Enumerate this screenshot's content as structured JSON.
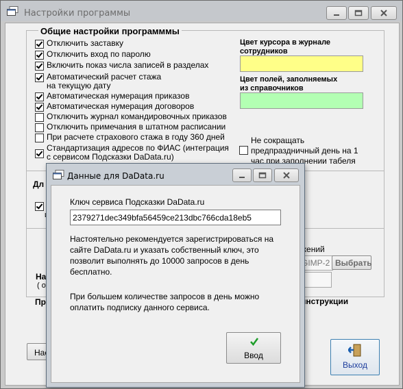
{
  "main_window": {
    "title": "Настройки программы",
    "general_group": {
      "legend": "Общие настройки программмы",
      "options": [
        {
          "label": "Отключить заставку",
          "checked": true
        },
        {
          "label": "Отключить вход по паролю",
          "checked": true
        },
        {
          "label": "Включить показ числа записей в разделах",
          "checked": true
        },
        {
          "label_line1": "Автоматический расчет стажа",
          "label_line2": "на текущую дату",
          "checked": true
        },
        {
          "label": "Автоматическая нумерация приказов",
          "checked": true
        },
        {
          "label": "Автоматическая нумерация договоров",
          "checked": true
        },
        {
          "label": "Отключить журнал командировочных приказов",
          "checked": false
        },
        {
          "label": "Отключить примечания в штатном расписании",
          "checked": false
        },
        {
          "label": "При расчете страхового стажа в году 360 дней",
          "checked": false
        },
        {
          "label_line1": "Стандартизация адресов по ФИАС (интеграция",
          "label_line2": "с сервисом Подсказки DaData.ru)",
          "checked": true
        }
      ],
      "cursor_color_label_line1": "Цвет курсора в журнале",
      "cursor_color_label_line2": "сотрудников",
      "cursor_color": "#ffff88",
      "lookup_color_label_line1": "Цвет полей, заполняемых",
      "lookup_color_label_line2": "из справочников",
      "lookup_color": "#b3ffb3",
      "holiday_option": {
        "line1": "Не сокращать",
        "line2": "предпраздничный день на 1",
        "line3": "час при заполнении табеля",
        "checked": false
      }
    },
    "partial": {
      "dl": "Дл",
      "p": "П",
      "c": "ц",
      "nazh": "Наз",
      "ot": "( от",
      "pri": "При",
      "nas": "Нас",
      "images": "жений",
      "gimp": "GIMP-2",
      "choose": "Выбрать",
      "instructions": "инструкции"
    },
    "exit_button": "Выход"
  },
  "dialog": {
    "title": "Данные для DaData.ru",
    "key_label": "Ключ сервиса Подсказки DaData.ru",
    "key_value": "2379271dec349bfa56459ce213dbc766cda18eb5",
    "info1_line1": "Настоятельно рекомендуется зарегистрироваться на",
    "info1_line2": "сайте DaData.ru и указать собственный ключ, это",
    "info1_line3": "позволит выполнять до 10000 запросов в день",
    "info1_line4": "бесплатно.",
    "info2_line1": "При большем количестве запросов в день можно",
    "info2_line2": "оплатить подписку данного сервиса.",
    "ok_button": "Ввод"
  }
}
